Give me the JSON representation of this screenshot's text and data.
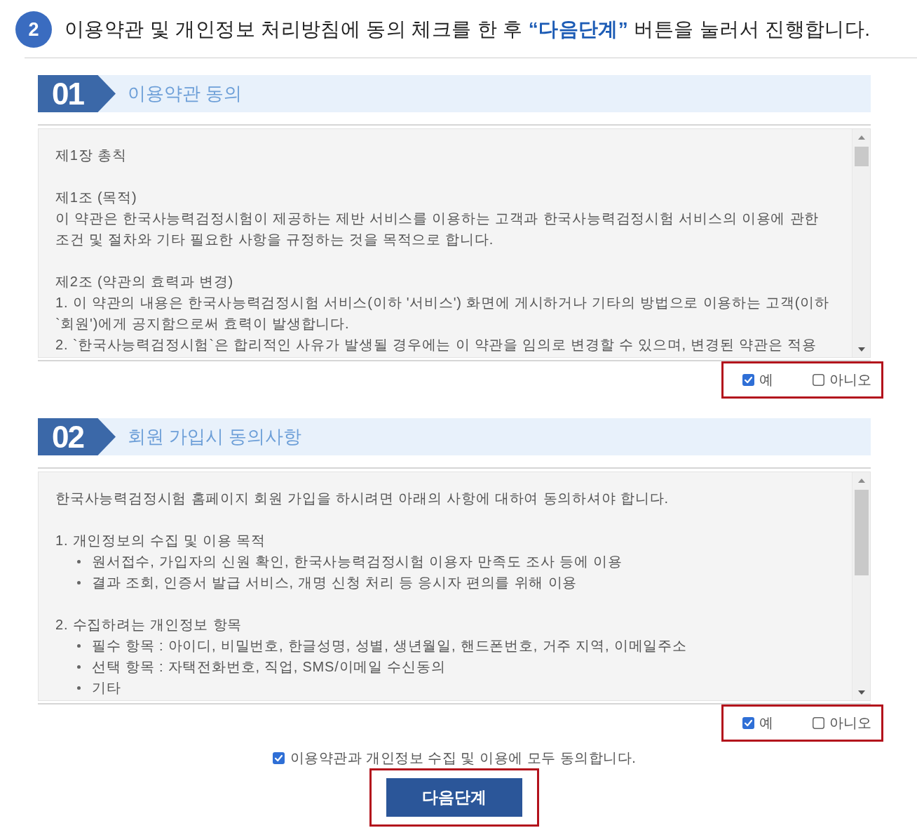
{
  "instruction": {
    "step": "2",
    "text": "이용약관 및 개인정보 처리방침에 동의 체크를 한 후 **“다음단계”** 버튼을 눌러서 진행합니다."
  },
  "sections": [
    {
      "number": "01",
      "title": "이용약관 동의",
      "content": [
        [
          {
            "kind": "line",
            "text": "제1장 총칙"
          }
        ],
        [
          {
            "kind": "line",
            "text": "제1조 (목적)"
          },
          {
            "kind": "line",
            "text": "이 약관은 한국사능력검정시험이 제공하는 제반 서비스를 이용하는 고객과 한국사능력검정시험 서비스의 이용에 관한 조건 및 절차와 기타 필요한 사항을 규정하는 것을 목적으로 합니다."
          }
        ],
        [
          {
            "kind": "line",
            "text": "제2조 (약관의 효력과 변경)"
          },
          {
            "kind": "line",
            "text": "1. 이 약관의 내용은 한국사능력검정시험 서비스(이하 '서비스') 화면에 게시하거나 기타의 방법으로 이용하는 고객(이하 `회원')에게 공지함으로써 효력이 발생합니다."
          },
          {
            "kind": "line",
            "text": "2. `한국사능력검정시험`은 합리적인 사유가 발생될 경우에는 이 약관을 임의로 변경할 수 있으며, 변경된 약관은 적용"
          }
        ]
      ],
      "choices": [
        {
          "label": "예",
          "checked": true
        },
        {
          "label": "아니오",
          "checked": false
        }
      ],
      "highlighted": true
    },
    {
      "number": "02",
      "title": "회원 가입시 동의사항",
      "content": [
        [
          {
            "kind": "line",
            "text": "한국사능력검정시험 홈페이지 회원 가입을 하시려면 아래의 사항에 대하여 동의하셔야 합니다."
          }
        ],
        [
          {
            "kind": "line",
            "text": "1. 개인정보의 수집 및 이용 목적"
          },
          {
            "kind": "bullet",
            "text": "원서접수, 가입자의 신원 확인, 한국사능력검정시험 이용자 만족도 조사 등에 이용"
          },
          {
            "kind": "bullet",
            "text": "결과 조회, 인증서 발급 서비스, 개명 신청 처리 등 응시자 편의를 위해 이용"
          }
        ],
        [
          {
            "kind": "line",
            "text": "2. 수집하려는 개인정보 항목"
          },
          {
            "kind": "bullet",
            "text": "필수 항목 : 아이디, 비밀번호, 한글성명, 성별, 생년월일, 핸드폰번호, 거주 지역, 이메일주소"
          },
          {
            "kind": "bullet",
            "text": "선택 항목 : 자택전화번호, 직업, SMS/이메일 수신동의"
          },
          {
            "kind": "bullet",
            "text": "기타"
          }
        ]
      ],
      "choices": [
        {
          "label": "예",
          "checked": true
        },
        {
          "label": "아니오",
          "checked": false
        }
      ],
      "highlighted": true
    }
  ],
  "agree_all": {
    "label": "이용약관과 개인정보 수집 및 이용에 모두 동의합니다.",
    "checked": true
  },
  "next_button": {
    "label": "다음단계",
    "highlighted": true
  }
}
